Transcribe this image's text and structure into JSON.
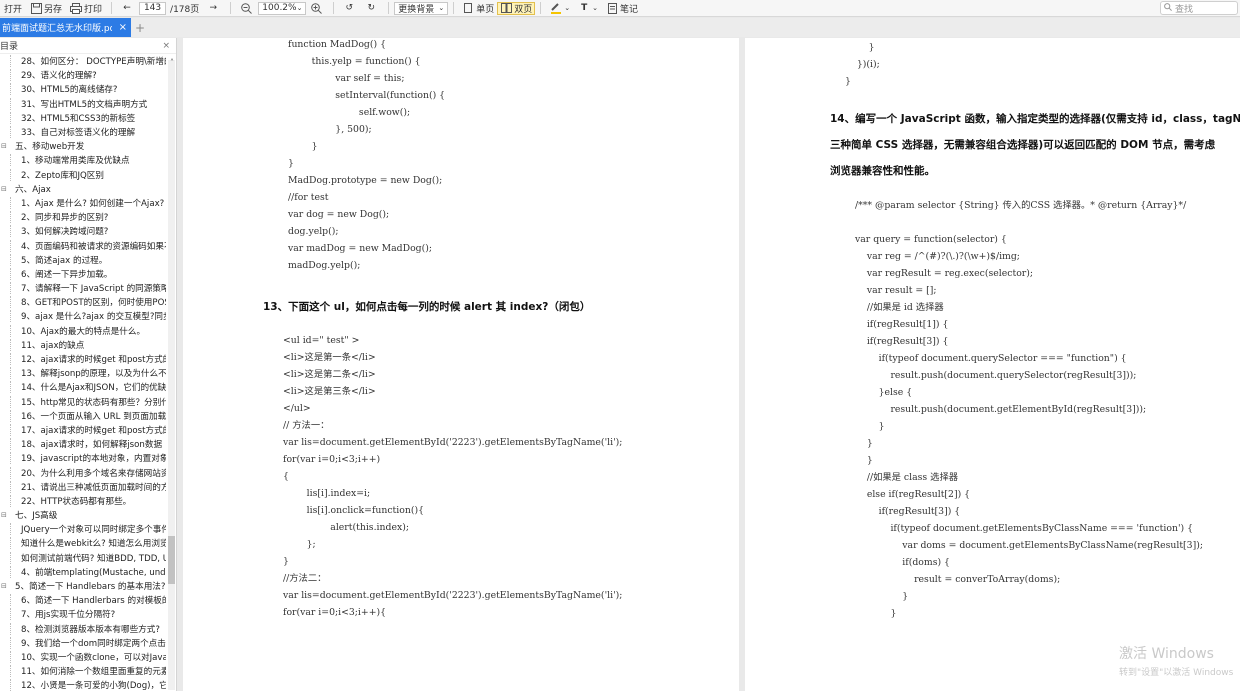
{
  "toolbar": {
    "open": "打开",
    "save_as": "另存",
    "print": "打印",
    "page_current": "143",
    "page_total": "/178页",
    "zoom": "100.2%",
    "background": "更换背景",
    "single_page": "单页",
    "double_page": "双页",
    "notes": "笔记",
    "search_placeholder": "查找"
  },
  "tab": {
    "title": "前端面试题汇总无水印版.pdf"
  },
  "sidebar": {
    "title": "目录",
    "items": [
      {
        "level": 2,
        "text": "28、如何区分： DOCTYPE声明\\新增的"
      },
      {
        "level": 2,
        "text": "29、语义化的理解?"
      },
      {
        "level": 2,
        "text": "30、HTML5的离线储存?"
      },
      {
        "level": 2,
        "text": "31、写出HTML5的文档声明方式"
      },
      {
        "level": 2,
        "text": "32、HTML5和CSS3的新标签"
      },
      {
        "level": 2,
        "text": "33、自己对标签语义化的理解"
      },
      {
        "level": 1,
        "text": "五、移动web开发"
      },
      {
        "level": 2,
        "text": "1、移动端常用类库及优缺点"
      },
      {
        "level": 2,
        "text": "2、Zepto库和JQ区别"
      },
      {
        "level": 1,
        "text": "六、Ajax"
      },
      {
        "level": 2,
        "text": "1、Ajax 是什么? 如何创建一个Ajax?"
      },
      {
        "level": 2,
        "text": "2、同步和异步的区别?"
      },
      {
        "level": 2,
        "text": "3、如何解决跨域问题?"
      },
      {
        "level": 2,
        "text": "4、页面编码和被请求的资源编码如果不"
      },
      {
        "level": 2,
        "text": "5、简述ajax 的过程。"
      },
      {
        "level": 2,
        "text": "6、阐述一下异步加载。"
      },
      {
        "level": 2,
        "text": "7、请解释一下 JavaScript 的同源策略"
      },
      {
        "level": 2,
        "text": "8、GET和POST的区别，何时使用POST"
      },
      {
        "level": 2,
        "text": "9、ajax 是什么?ajax 的交互模型?同步"
      },
      {
        "level": 2,
        "text": "10、Ajax的最大的特点是什么。"
      },
      {
        "level": 2,
        "text": "11、ajax的缺点"
      },
      {
        "level": 2,
        "text": "12、ajax请求的时候get 和post方式的"
      },
      {
        "level": 2,
        "text": "13、解释jsonp的原理，以及为什么不"
      },
      {
        "level": 2,
        "text": "14、什么是Ajax和JSON，它们的优缺"
      },
      {
        "level": 2,
        "text": "15、http常见的状态码有那些？分别代"
      },
      {
        "level": 2,
        "text": "16、一个页面从输入 URL 到页面加载"
      },
      {
        "level": 2,
        "text": "17、ajax请求的时候get 和post方式的"
      },
      {
        "level": 2,
        "text": "18、ajax请求时，如何解释json数据"
      },
      {
        "level": 2,
        "text": "19、javascript的本地对象，内置对象"
      },
      {
        "level": 2,
        "text": "20、为什么利用多个域名来存储网站资"
      },
      {
        "level": 2,
        "text": "21、请说出三种减低页面加载时间的方"
      },
      {
        "level": 2,
        "text": "22、HTTP状态码都有那些。"
      },
      {
        "level": 1,
        "text": "七、JS高级"
      },
      {
        "level": 2,
        "text": "JQuery一个对象可以同时绑定多个事件"
      },
      {
        "level": 2,
        "text": "知道什么是webkit么? 知道怎么用浏览"
      },
      {
        "level": 2,
        "text": "如何测试前端代码? 知道BDD, TDD, U"
      },
      {
        "level": 2,
        "text": "4、前端templating(Mustache, unde"
      },
      {
        "level": 1,
        "text": "5、简述一下 Handlebars 的基本用法?"
      },
      {
        "level": 2,
        "text": "6、简述一下 Handlerbars 的对模板的"
      },
      {
        "level": 2,
        "text": "7、用js实现千位分隔符?"
      },
      {
        "level": 2,
        "text": "8、检测浏览器版本版本有哪些方式?"
      },
      {
        "level": 2,
        "text": "9、我们给一个dom同时绑定两个点击"
      },
      {
        "level": 2,
        "text": "10、实现一个函数clone，可以对Java"
      },
      {
        "level": 2,
        "text": "11、如何消除一个数组里面重复的元素"
      },
      {
        "level": 2,
        "text": "12、小贤是一条可爱的小狗(Dog)，它"
      }
    ]
  },
  "left_page": {
    "code_top": "function MadDog() {\n        this.yelp = function() {\n                var self = this;\n                setInterval(function() {\n                        self.wow();\n                }, 500);\n        }\n}\nMadDog.prototype = new Dog();\n//for test\nvar dog = new Dog();\ndog.yelp();\nvar madDog = new MadDog();\nmadDog.yelp();",
    "heading": "13、下面这个 ul，如何点击每一列的时候 alert 其 index?（闭包）",
    "code_bottom": "<ul id=\" test\" >\n<li>这是第一条</li>\n<li>这是第二条</li>\n<li>这是第三条</li>\n</ul>\n// 方法一：\nvar lis=document.getElementById('2223').getElementsByTagName('li');\nfor(var i=0;i<3;i++)\n{\n        lis[i].index=i;\n        lis[i].onclick=function(){\n                alert(this.index);\n        };\n}\n//方法二：\nvar lis=document.getElementById('2223').getElementsByTagName('li');\nfor(var i=0;i<3;i++){"
  },
  "right_page": {
    "code_top": "        }\n    })(i);\n}",
    "heading_lines": [
      "14、编写一个 JavaScript 函数，输入指定类型的选择器(仅需支持 id，class，tagName",
      "三种简单 CSS 选择器，无需兼容组合选择器)可以返回匹配的 DOM 节点，需考虑",
      "浏览器兼容性和性能。"
    ],
    "code_bottom": "/*** @param selector {String} 传入的CSS 选择器。* @return {Array}*/\n\nvar query = function(selector) {\n    var reg = /^(#)?(\\.)?(\\w+)$/img;\n    var regResult = reg.exec(selector);\n    var result = [];\n    //如果是 id 选择器\n    if(regResult[1]) {\n    if(regResult[3]) {\n        if(typeof document.querySelector === \"function\") {\n            result.push(document.querySelector(regResult[3]));\n        }else {\n            result.push(document.getElementById(regResult[3]));\n        }\n    }\n    }\n    //如果是 class 选择器\n    else if(regResult[2]) {\n        if(regResult[3]) {\n            if(typeof document.getElementsByClassName === 'function') {\n                var doms = document.getElementsByClassName(regResult[3]);\n                if(doms) {\n                    result = converToArray(doms);\n                }\n            }"
  },
  "watermark": {
    "line1": "激活 Windows",
    "line2": "转到\"设置\"以激活 Windows"
  },
  "colors": {
    "tab_active": "#2c7be5",
    "toolbar_bg": "#f6f6f6",
    "highlight": "#fff3b8"
  }
}
